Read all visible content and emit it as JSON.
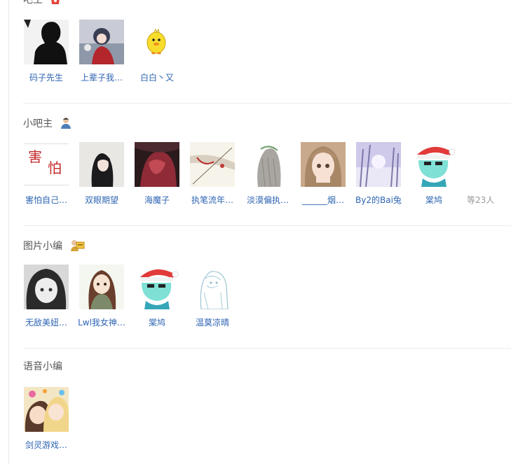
{
  "sections": {
    "owners": {
      "title": "吧主",
      "members": [
        {
          "name": "码子先生"
        },
        {
          "name": "上辈子我…"
        },
        {
          "name": "白白丶又"
        }
      ]
    },
    "small_owners": {
      "title": "小吧主",
      "members": [
        {
          "name": "害怕自己…"
        },
        {
          "name": "双眼期望"
        },
        {
          "name": "海魔子"
        },
        {
          "name": "执笔流年…"
        },
        {
          "name": "淡漠偏执…"
        },
        {
          "name": "______烟…"
        },
        {
          "name": "By2的Bai兔"
        },
        {
          "name": "棠鸠"
        }
      ],
      "more": "等23人"
    },
    "picture_editors": {
      "title": "图片小编",
      "members": [
        {
          "name": "无敌美妞…"
        },
        {
          "name": "Lwl我女神…"
        },
        {
          "name": "棠鸠"
        },
        {
          "name": "温莫凉晴"
        }
      ]
    },
    "voice_editors": {
      "title": "语音小编",
      "members": [
        {
          "name": "剑灵游戏…"
        }
      ]
    }
  },
  "colors": {
    "link": "#2d64b3",
    "title": "#555555",
    "divider": "#ececec",
    "badge_red": "#e2463c"
  }
}
